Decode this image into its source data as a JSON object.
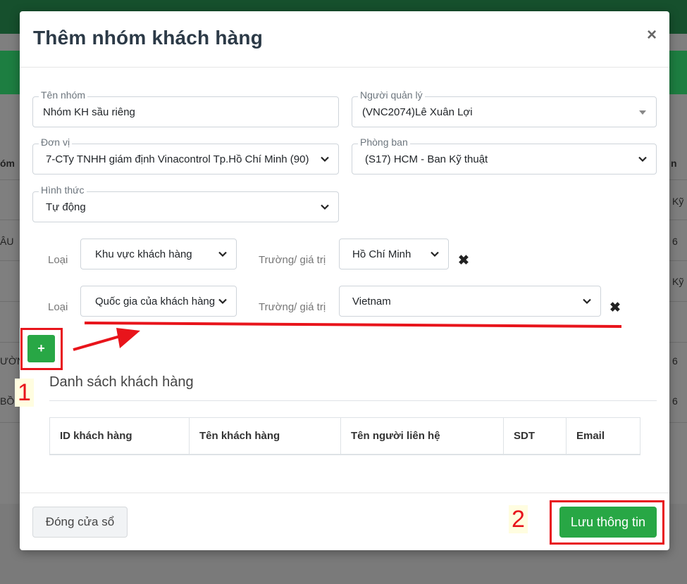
{
  "background": {
    "column_header_left": "óm",
    "column_header_right": "n",
    "cells_left": [
      "ÂU",
      "ƯỜN",
      "BỒN"
    ],
    "cells_right": [
      "Kỹ",
      "6",
      "Kỹ",
      "6",
      "6"
    ]
  },
  "modal": {
    "title": "Thêm nhóm khách hàng",
    "close_glyph": "×",
    "form": {
      "group_name": {
        "label": "Tên nhóm",
        "value": "Nhóm KH sầu riêng"
      },
      "manager": {
        "label": "Người quản lý",
        "value": "(VNC2074)Lê Xuân Lợi"
      },
      "unit": {
        "label": "Đơn vị",
        "value": "7-CTy TNHH giám định Vinacontrol Tp.Hồ Chí Minh (90)"
      },
      "department": {
        "label": "Phòng ban",
        "value": "(S17) HCM - Ban Kỹ thuật"
      },
      "mode": {
        "label": "Hình thức",
        "value": "Tự động"
      }
    },
    "conditions": [
      {
        "type_label": "Loại",
        "type_value": "Khu vực khách hàng",
        "field_label": "Trường/ giá trị",
        "field_value": "Hồ Chí Minh",
        "delete_glyph": "✖"
      },
      {
        "type_label": "Loại",
        "type_value": "Quốc gia của khách hàng",
        "field_label": "Trường/ giá trị",
        "field_value": "Vietnam",
        "delete_glyph": "✖"
      }
    ],
    "add_button": "+",
    "customer_list": {
      "title": "Danh sách khách hàng",
      "columns": [
        "ID khách hàng",
        "Tên khách hàng",
        "Tên người liên hệ",
        "SDT",
        "Email"
      ]
    },
    "footer": {
      "close_label": "Đóng cửa sổ",
      "save_label": "Lưu thông tin"
    }
  },
  "annotations": {
    "step1": "1",
    "step2": "2",
    "color": "#e8141b"
  },
  "colors": {
    "primary_green": "#28a745",
    "topbar": "#16502d",
    "greenbar": "#1d7e41"
  }
}
